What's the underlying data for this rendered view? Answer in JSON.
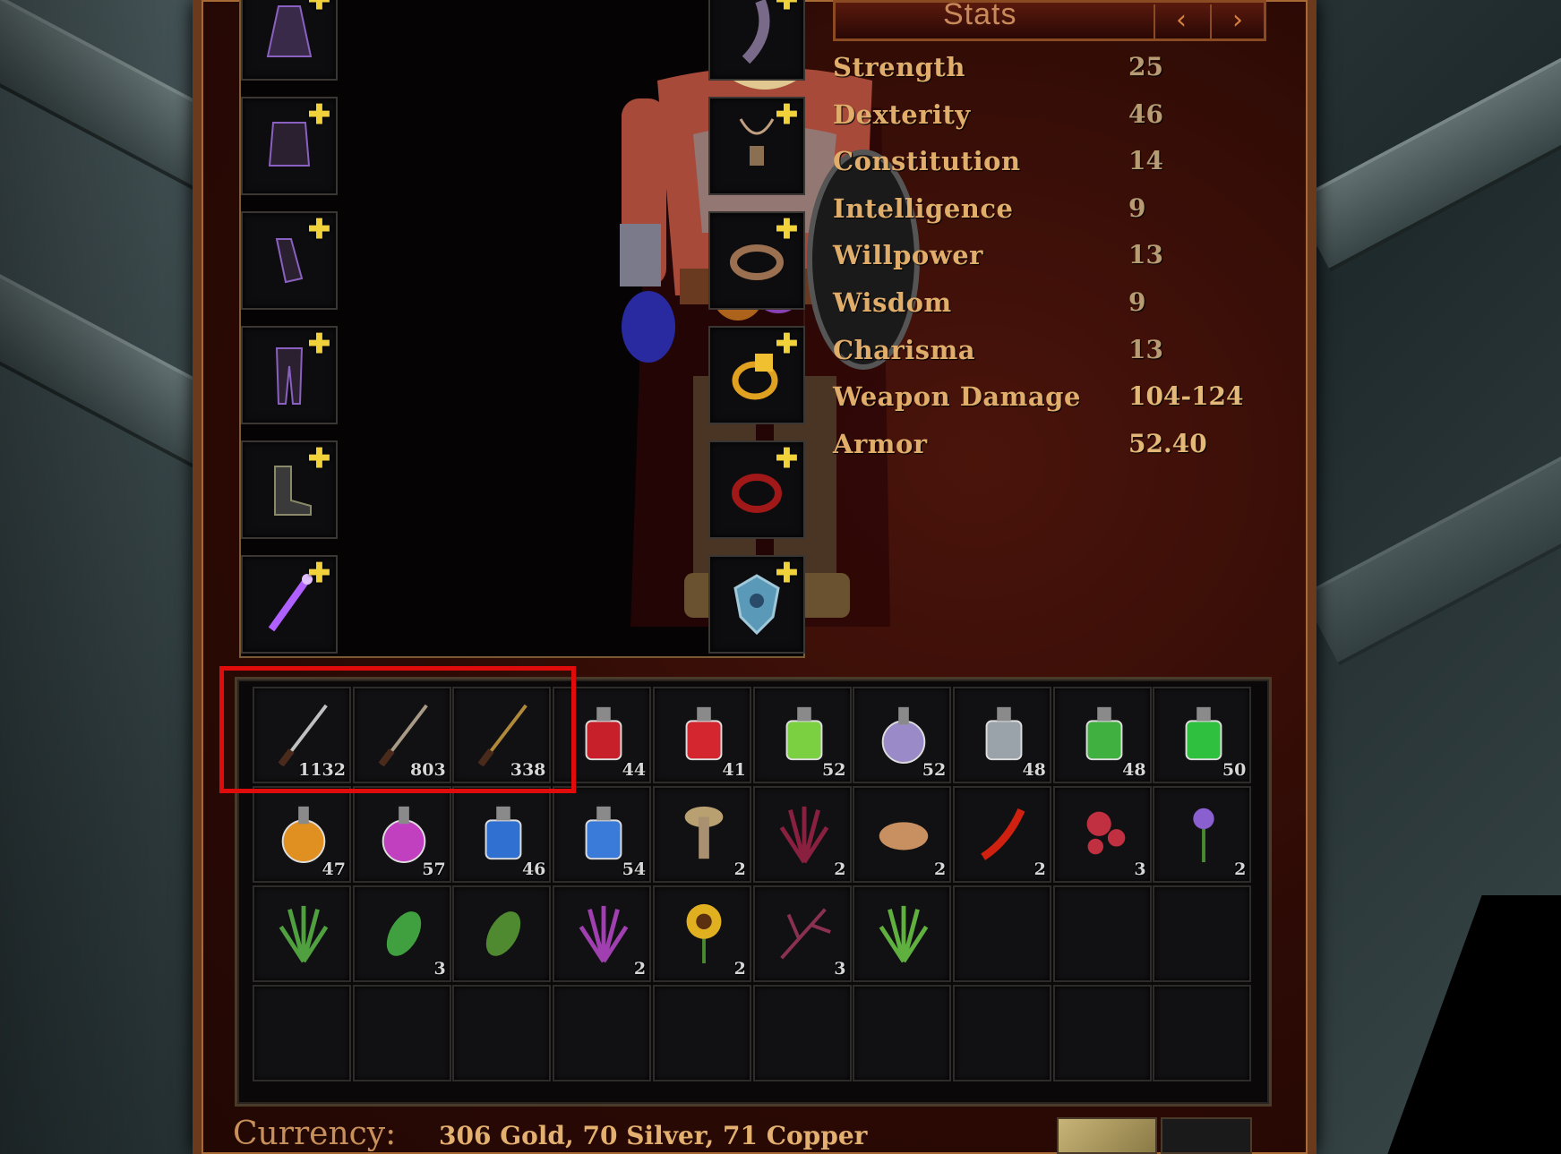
{
  "stats": {
    "title": "Stats",
    "prev_label": "‹",
    "next_label": "›",
    "rows": [
      {
        "label": "Strength",
        "value": "25"
      },
      {
        "label": "Dexterity",
        "value": "46"
      },
      {
        "label": "Constitution",
        "value": "14"
      },
      {
        "label": "Intelligence",
        "value": "9"
      },
      {
        "label": "Willpower",
        "value": "13"
      },
      {
        "label": "Wisdom",
        "value": "9"
      },
      {
        "label": "Charisma",
        "value": "13"
      },
      {
        "label": "Weapon Damage",
        "value": "104-124"
      },
      {
        "label": "Armor",
        "value": "52.40"
      }
    ]
  },
  "equipment": {
    "left": [
      "cloak-icon",
      "chest-armor-icon",
      "gloves-icon",
      "pants-icon",
      "boots-icon",
      "wand-icon"
    ],
    "right": [
      "tail-icon",
      "amulet-icon",
      "belt-icon",
      "gold-ring-icon",
      "red-ring-icon",
      "shield-icon"
    ],
    "plus_glyph": "✚"
  },
  "inventory": {
    "rows": [
      [
        {
          "icon": "fishing-rod-icon",
          "count": "1132",
          "color": "#c0c0c0"
        },
        {
          "icon": "fishing-rod-icon",
          "count": "803",
          "color": "#a89a86"
        },
        {
          "icon": "fishing-rod-icon",
          "count": "338",
          "color": "#b08a3a"
        },
        {
          "icon": "red-potion-icon",
          "count": "44",
          "color": "#c8202a"
        },
        {
          "icon": "red-potion-icon",
          "count": "41",
          "color": "#d4262e"
        },
        {
          "icon": "green-potion-icon",
          "count": "52",
          "color": "#7ad040"
        },
        {
          "icon": "purple-potion-icon",
          "count": "52",
          "color": "#9a8ac8"
        },
        {
          "icon": "grey-potion-icon",
          "count": "48",
          "color": "#9aa2aa"
        },
        {
          "icon": "green-potion-icon",
          "count": "48",
          "color": "#40b040"
        },
        {
          "icon": "green-potion-icon",
          "count": "50",
          "color": "#30c040"
        }
      ],
      [
        {
          "icon": "orange-potion-icon",
          "count": "47",
          "color": "#e09020"
        },
        {
          "icon": "magenta-potion-icon",
          "count": "57",
          "color": "#c040c0"
        },
        {
          "icon": "blue-potion-icon",
          "count": "46",
          "color": "#3070d0"
        },
        {
          "icon": "blue-potion-icon",
          "count": "54",
          "color": "#3a7ad8"
        },
        {
          "icon": "mushroom-icon",
          "count": "2",
          "color": "#b8a070"
        },
        {
          "icon": "herb-icon",
          "count": "2",
          "color": "#8a2040"
        },
        {
          "icon": "bread-icon",
          "count": "2",
          "color": "#c89060"
        },
        {
          "icon": "chili-icon",
          "count": "2",
          "color": "#d02010"
        },
        {
          "icon": "berries-icon",
          "count": "3",
          "color": "#c03040"
        },
        {
          "icon": "flower-icon",
          "count": "2",
          "color": "#8a60d0"
        }
      ],
      [
        {
          "icon": "herb-icon",
          "count": "",
          "color": "#50a040"
        },
        {
          "icon": "leaf-icon",
          "count": "3",
          "color": "#40a040"
        },
        {
          "icon": "leaf-icon",
          "count": "",
          "color": "#508a30"
        },
        {
          "icon": "lavender-icon",
          "count": "2",
          "color": "#a040b0"
        },
        {
          "icon": "sunflower-icon",
          "count": "2",
          "color": "#e0b020"
        },
        {
          "icon": "twig-icon",
          "count": "3",
          "color": "#8a3050"
        },
        {
          "icon": "grass-icon",
          "count": "",
          "color": "#60b040"
        },
        {
          "icon": "empty",
          "count": "",
          "color": ""
        },
        {
          "icon": "empty",
          "count": "",
          "color": ""
        },
        {
          "icon": "empty",
          "count": "",
          "color": ""
        }
      ],
      [
        {
          "icon": "empty",
          "count": "",
          "color": ""
        },
        {
          "icon": "empty",
          "count": "",
          "color": ""
        },
        {
          "icon": "empty",
          "count": "",
          "color": ""
        },
        {
          "icon": "empty",
          "count": "",
          "color": ""
        },
        {
          "icon": "empty",
          "count": "",
          "color": ""
        },
        {
          "icon": "empty",
          "count": "",
          "color": ""
        },
        {
          "icon": "empty",
          "count": "",
          "color": ""
        },
        {
          "icon": "empty",
          "count": "",
          "color": ""
        },
        {
          "icon": "empty",
          "count": "",
          "color": ""
        },
        {
          "icon": "empty",
          "count": "",
          "color": ""
        }
      ]
    ]
  },
  "currency": {
    "label": "Currency:",
    "value": "306 Gold, 70 Silver, 71 Copper"
  },
  "colors": {
    "highlight": "#e00b0b",
    "stat_label": "#e0ad6a",
    "plus_marker": "#f2d23a"
  }
}
